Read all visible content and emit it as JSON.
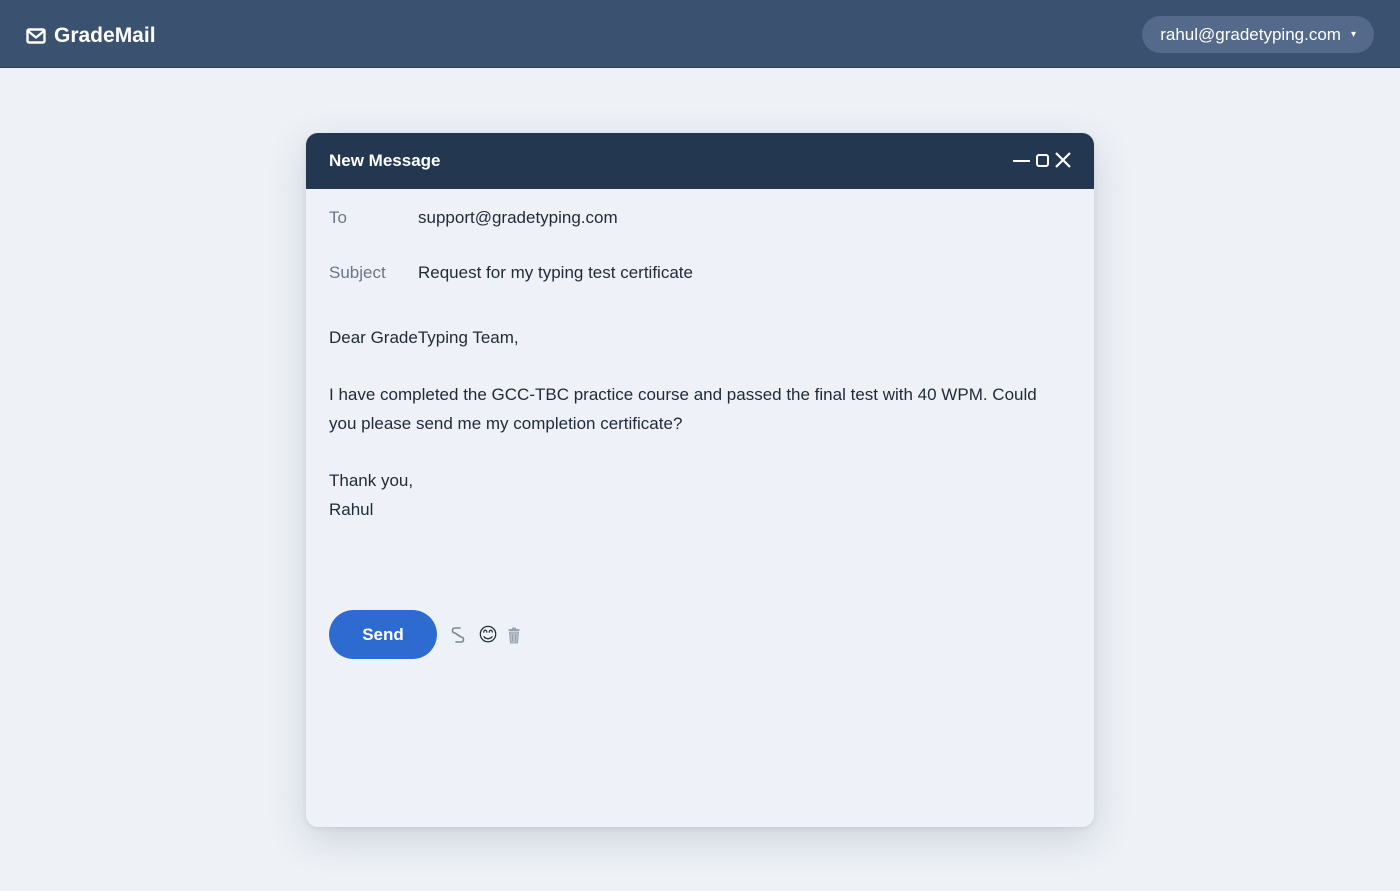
{
  "app": {
    "name": "GradeMail",
    "logo_icon": "envelope-icon"
  },
  "account": {
    "email": "rahul@gradetyping.com",
    "caret": "▾"
  },
  "compose": {
    "title": "New Message",
    "controls": [
      "minimize-icon",
      "maximize-icon",
      "close-icon"
    ],
    "to_label": "To",
    "to_value": "support@gradetyping.com",
    "subject_label": "Subject",
    "subject_value": "Request for my typing test certificate",
    "body": {
      "greeting": "Dear GradeTyping Team,",
      "paragraph_line1": "I have completed the GCC-TBC practice course and passed the final test with 40 WPM. Could",
      "paragraph_line2": "you please send me my completion certificate?",
      "signoff": "Thank you,",
      "signature": "Rahul"
    },
    "send_label": "Send",
    "tools": [
      {
        "icon": "link-icon"
      },
      {
        "icon": "emoji-icon",
        "glyph": "😊"
      },
      {
        "icon": "trash-icon"
      }
    ]
  },
  "colors": {
    "topbar": "#3a5270",
    "compose_header": "#233750",
    "send_button": "#2e6bd0",
    "background": "#eef2f7"
  }
}
